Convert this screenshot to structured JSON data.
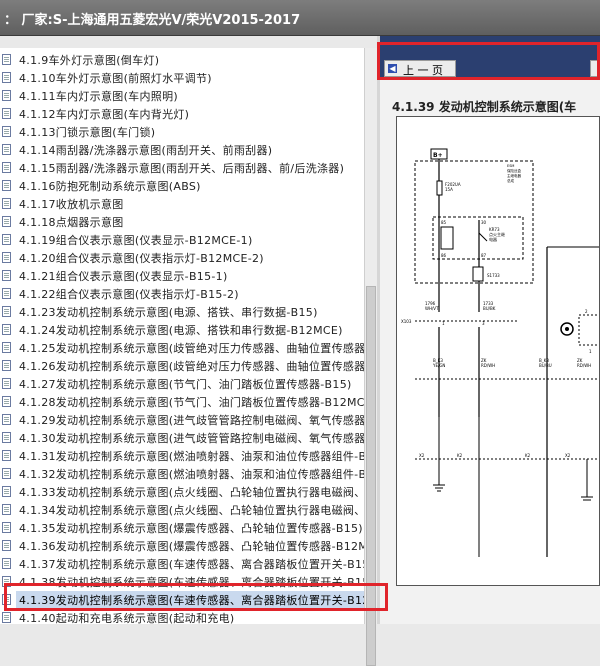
{
  "window": {
    "title": "： 厂家:S-上海通用五菱宏光V/荣光V2015-2017"
  },
  "tree": {
    "items": [
      "4.1.9车外灯示意图(倒车灯)",
      "4.1.10车外灯示意图(前照灯水平调节)",
      "4.1.11车内灯示意图(车内照明)",
      "4.1.12车内灯示意图(车内背光灯)",
      "4.1.13门锁示意图(车门锁)",
      "4.1.14雨刮器/洗涤器示意图(雨刮开关、前雨刮器)",
      "4.1.15雨刮器/洗涤器示意图(雨刮开关、后雨刮器、前/后洗涤器)",
      "4.1.16防抱死制动系统示意图(ABS)",
      "4.1.17收放机示意图",
      "4.1.18点烟器示意图",
      "4.1.19组合仪表示意图(仪表显示-B12MCE-1)",
      "4.1.20组合仪表示意图(仪表指示灯-B12MCE-2)",
      "4.1.21组合仪表示意图(仪表显示-B15-1)",
      "4.1.22组合仪表示意图(仪表指示灯-B15-2)",
      "4.1.23发动机控制系统示意图(电源、搭铁、串行数据-B15)",
      "4.1.24发动机控制系统示意图(电源、搭铁和串行数据-B12MCE)",
      "4.1.25发动机控制系统示意图(歧管绝对压力传感器、曲轴位置传感器-",
      "4.1.26发动机控制系统示意图(歧管绝对压力传感器、曲轴位置传感器-",
      "4.1.27发动机控制系统示意图(节气门、油门踏板位置传感器-B15)",
      "4.1.28发动机控制系统示意图(节气门、油门踏板位置传感器-B12MCI",
      "4.1.29发动机控制系统示意图(进气歧管管路控制电磁阀、氧气传感器-",
      "4.1.30发动机控制系统示意图(进气歧管管路控制电磁阀、氧气传感器-",
      "4.1.31发动机控制系统示意图(燃油喷射器、油泵和油位传感器组件-B",
      "4.1.32发动机控制系统示意图(燃油喷射器、油泵和油位传感器组件-B",
      "4.1.33发动机控制系统示意图(点火线圈、凸轮轴位置执行器电磁阀、",
      "4.1.34发动机控制系统示意图(点火线圈、凸轮轴位置执行器电磁阀、",
      "4.1.35发动机控制系统示意图(爆震传感器、凸轮轴位置传感器-B15)",
      "4.1.36发动机控制系统示意图(爆震传感器、凸轮轴位置传感器-B12M",
      "4.1.37发动机控制系统示意图(车速传感器、离合器踏板位置开关-B15",
      "4.1.38发动机控制系统示意图(车速传感器、离合器踏板位置开关-B15",
      "4.1.39发动机控制系统示意图(车速传感器、离合器踏板位置开关-B12",
      "4.1.40起动和充电系统示意图(起动和充电)"
    ],
    "selected_index": 30
  },
  "viewer": {
    "prev_button": "上 一 页",
    "prev_icon": "left-arrow-icon",
    "heading": "4.1.39 发动机控制系统示意图(车",
    "diagram": {
      "b_plus": "B+",
      "relay_box_label": "ESM\n保险丝盒\n主继电器\n总成",
      "fuse": "F202UA\n15A",
      "relay": "KR73\n点火主继\n电器",
      "pins": [
        "85",
        "86",
        "30",
        "87"
      ],
      "switch_label": "S1733",
      "wire1": "1796\nWH/VT",
      "wire2": "1733\nBU/BK",
      "connector_x": "X103",
      "connector_pins": [
        "1",
        "3"
      ],
      "wire_labels": [
        "B_K3\nYE/GN",
        "ZK\nRD/WH",
        "B_K3\nBU/BU",
        "ZK\nRD/WH"
      ],
      "module_pins": [
        "2",
        "1"
      ],
      "ground_labels": [
        "X2",
        "K2",
        "K2",
        "X2"
      ]
    }
  },
  "colors": {
    "highlight": "#e0242b",
    "nav": "#2b3f70",
    "selected": "#c9d9ee"
  }
}
